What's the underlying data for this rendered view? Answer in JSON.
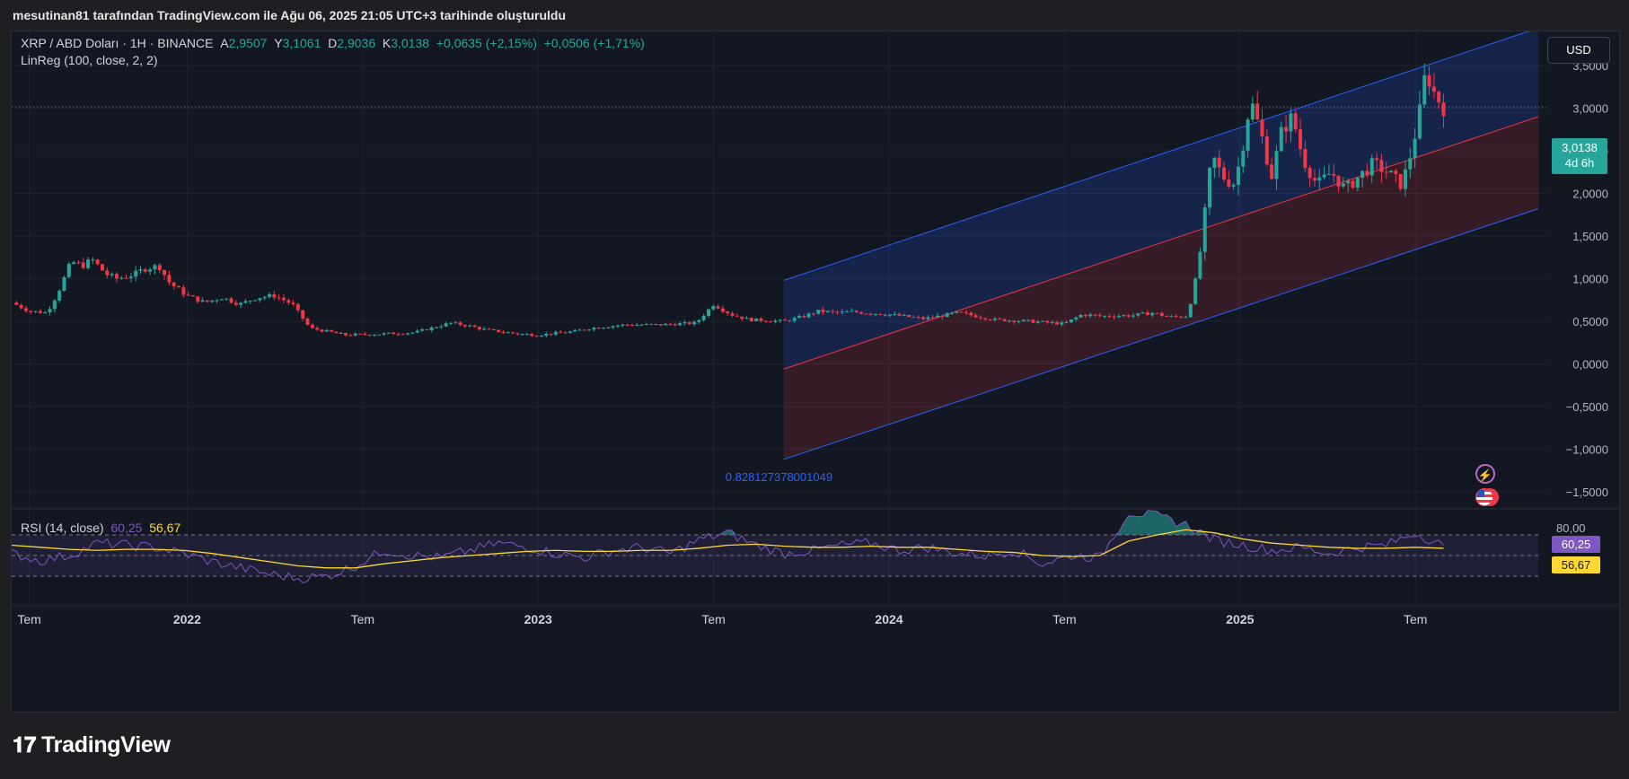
{
  "header": {
    "snapshot_text": "mesutinan81 tarafından TradingView.com ile Ağu 06, 2025 21:05 UTC+3 tarihinde oluşturuldu"
  },
  "legend": {
    "symbol": "XRP / ABD Doları · 1H · BINANCE",
    "open_label": "A",
    "open": "2,9507",
    "high_label": "Y",
    "high": "3,1061",
    "low_label": "D",
    "low": "2,9036",
    "close_label": "K",
    "close": "3,0138",
    "change": "+0,0635 (+2,15%)",
    "change2": "+0,0506 (+1,71%)",
    "indicator": "LinReg (100, close, 2, 2)"
  },
  "currency_button": "USD",
  "last_price": {
    "value": "3,0138",
    "countdown": "4d 6h"
  },
  "regression_label": "0.828127378001049",
  "rsi": {
    "label": "RSI (14, close)",
    "rsi_value": "60,25",
    "ma_value": "56,67",
    "axis_label": "80,00"
  },
  "brand": "TradingView",
  "colors": {
    "up": "#26a69a",
    "down": "#f23645",
    "rsi": "#7e57c2",
    "rsi_ma": "#fdd835",
    "channel_line": "#2962ff",
    "mid_line": "#f23645",
    "background": "#131722"
  },
  "chart_data": {
    "type": "candlestick",
    "x_tick_labels": [
      "Tem",
      "2022",
      "Tem",
      "2023",
      "Tem",
      "2024",
      "Tem",
      "2025",
      "Tem"
    ],
    "y_tick_labels": [
      "3,5000",
      "3,0000",
      "2,5000",
      "2,0000",
      "1,5000",
      "1,0000",
      "0,5000",
      "0,0000",
      "−0,5000",
      "−1,0000",
      "−1,5000"
    ],
    "ylim": [
      -1.7,
      3.9
    ],
    "x_start": 2021.5,
    "x_end": 2025.85,
    "close_series": [
      [
        2021.5,
        0.72
      ],
      [
        2021.55,
        0.62
      ],
      [
        2021.6,
        0.6
      ],
      [
        2021.63,
        0.82
      ],
      [
        2021.67,
        1.2
      ],
      [
        2021.7,
        1.15
      ],
      [
        2021.73,
        1.22
      ],
      [
        2021.77,
        1.05
      ],
      [
        2021.8,
        1.0
      ],
      [
        2021.85,
        1.05
      ],
      [
        2021.88,
        1.12
      ],
      [
        2021.92,
        1.15
      ],
      [
        2021.95,
        0.95
      ],
      [
        2022.0,
        0.8
      ],
      [
        2022.05,
        0.72
      ],
      [
        2022.1,
        0.78
      ],
      [
        2022.15,
        0.7
      ],
      [
        2022.2,
        0.78
      ],
      [
        2022.25,
        0.8
      ],
      [
        2022.3,
        0.7
      ],
      [
        2022.35,
        0.42
      ],
      [
        2022.4,
        0.38
      ],
      [
        2022.45,
        0.34
      ],
      [
        2022.55,
        0.35
      ],
      [
        2022.65,
        0.37
      ],
      [
        2022.75,
        0.48
      ],
      [
        2022.8,
        0.45
      ],
      [
        2022.85,
        0.4
      ],
      [
        2022.95,
        0.35
      ],
      [
        2023.0,
        0.34
      ],
      [
        2023.1,
        0.38
      ],
      [
        2023.15,
        0.42
      ],
      [
        2023.25,
        0.46
      ],
      [
        2023.35,
        0.46
      ],
      [
        2023.45,
        0.48
      ],
      [
        2023.5,
        0.7
      ],
      [
        2023.55,
        0.58
      ],
      [
        2023.6,
        0.52
      ],
      [
        2023.7,
        0.5
      ],
      [
        2023.75,
        0.55
      ],
      [
        2023.8,
        0.62
      ],
      [
        2023.85,
        0.6
      ],
      [
        2023.9,
        0.61
      ],
      [
        2024.0,
        0.58
      ],
      [
        2024.1,
        0.53
      ],
      [
        2024.2,
        0.6
      ],
      [
        2024.3,
        0.52
      ],
      [
        2024.4,
        0.5
      ],
      [
        2024.5,
        0.47
      ],
      [
        2024.55,
        0.58
      ],
      [
        2024.6,
        0.56
      ],
      [
        2024.7,
        0.57
      ],
      [
        2024.75,
        0.6
      ],
      [
        2024.8,
        0.55
      ],
      [
        2024.85,
        0.56
      ],
      [
        2024.88,
        1.1
      ],
      [
        2024.92,
        2.45
      ],
      [
        2024.95,
        2.2
      ],
      [
        2024.98,
        2.1
      ],
      [
        2025.0,
        2.38
      ],
      [
        2025.03,
        3.1
      ],
      [
        2025.06,
        2.7
      ],
      [
        2025.09,
        2.2
      ],
      [
        2025.12,
        2.75
      ],
      [
        2025.15,
        2.9
      ],
      [
        2025.18,
        2.4
      ],
      [
        2025.22,
        2.1
      ],
      [
        2025.26,
        2.25
      ],
      [
        2025.3,
        2.05
      ],
      [
        2025.34,
        2.2
      ],
      [
        2025.38,
        2.35
      ],
      [
        2025.42,
        2.25
      ],
      [
        2025.46,
        2.1
      ],
      [
        2025.48,
        2.35
      ],
      [
        2025.51,
        2.9
      ],
      [
        2025.53,
        3.45
      ],
      [
        2025.55,
        3.2
      ],
      [
        2025.58,
        3.01
      ]
    ],
    "linreg_channel": {
      "x_start": 2023.7,
      "x_end": 2025.85,
      "mid_start": -0.06,
      "mid_end": 2.9,
      "upper_start": 0.98,
      "upper_end": 3.94,
      "lower_start": -1.12,
      "lower_end": 1.82
    },
    "rsi": {
      "ylim": [
        10,
        90
      ],
      "levels": [
        70,
        50,
        30
      ],
      "rsi_series": [
        52,
        45,
        50,
        62,
        60,
        58,
        52,
        44,
        38,
        32,
        28,
        30,
        40,
        55,
        50,
        48,
        55,
        62,
        58,
        52,
        48,
        55,
        58,
        52,
        65,
        72,
        60,
        52,
        55,
        60,
        62,
        55,
        58,
        52,
        50,
        55,
        42,
        50,
        48,
        92,
        88,
        80,
        65,
        60,
        55,
        58,
        52,
        58,
        60,
        72,
        60
      ],
      "ma_series": [
        60,
        58,
        56,
        55,
        56,
        56,
        55,
        52,
        48,
        44,
        40,
        38,
        38,
        42,
        45,
        48,
        50,
        52,
        54,
        55,
        54,
        54,
        55,
        55,
        57,
        60,
        61,
        59,
        58,
        58,
        59,
        58,
        58,
        56,
        54,
        53,
        50,
        49,
        50,
        64,
        70,
        75,
        72,
        66,
        62,
        60,
        58,
        57,
        57,
        58,
        57
      ]
    }
  }
}
